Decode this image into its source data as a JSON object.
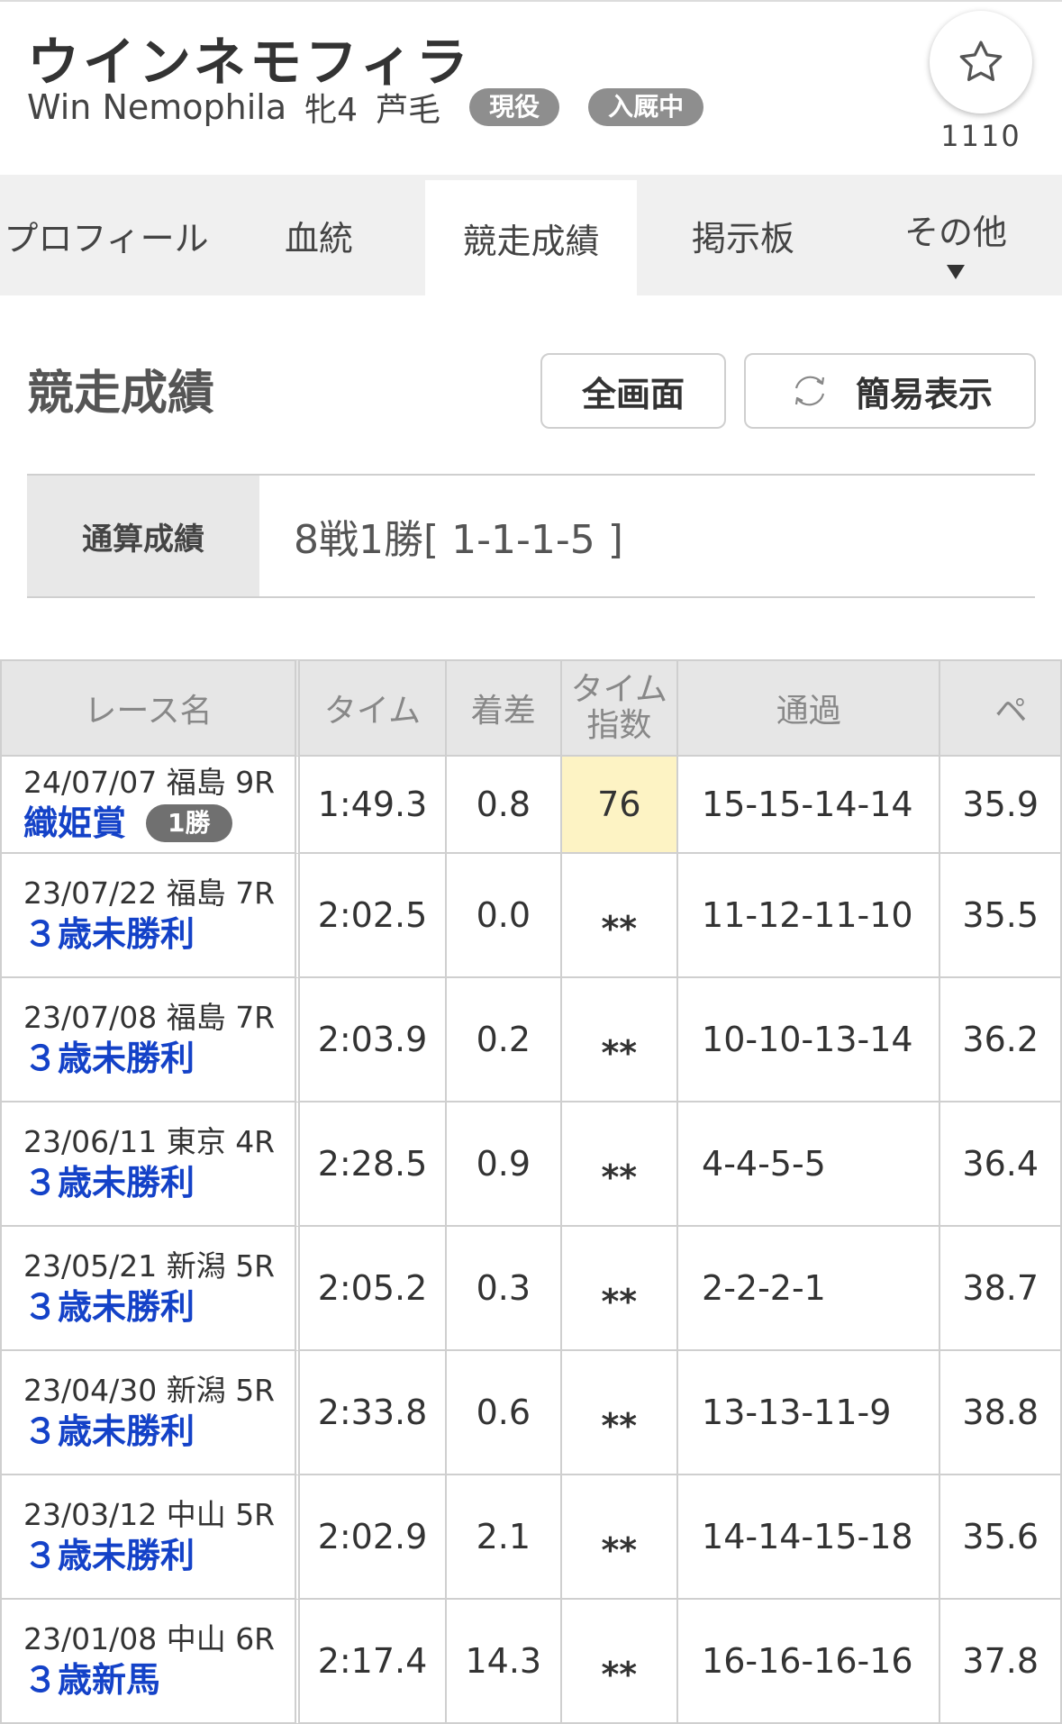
{
  "horse": {
    "name_jp": "ウインネモフィラ",
    "name_en": "Win Nemophila",
    "sex_age": "牝4",
    "coat": "芦毛",
    "status_badge": "現役",
    "stable_badge": "入厩中"
  },
  "favorite": {
    "icon": "star-icon",
    "count": "1110"
  },
  "tabs": [
    {
      "label": "プロフィール"
    },
    {
      "label": "血統"
    },
    {
      "label": "競走成績",
      "active": true
    },
    {
      "label": "掲示板"
    },
    {
      "label": "その他"
    }
  ],
  "section": {
    "title": "競走成績",
    "fullscreen_label": "全画面",
    "simple_label": "簡易表示",
    "simple_icon": "refresh-icon"
  },
  "summary": {
    "label": "通算成績",
    "value": "8戦1勝[ 1-1-1-5 ]"
  },
  "table": {
    "headers": {
      "race": "レース名",
      "time": "タイム",
      "margin": "着差",
      "time_index_1": "タイム",
      "time_index_2": "指数",
      "passing": "通過",
      "pace": "ペ"
    },
    "rows": [
      {
        "date_place": "24/07/07 福島 9R",
        "race": "織姫賞",
        "grade": "1勝",
        "time": "1:49.3",
        "margin": "0.8",
        "time_index": "76",
        "passing": "15-15-14-14",
        "pace": "35.9"
      },
      {
        "date_place": "23/07/22 福島 7R",
        "race": "３歳未勝利",
        "grade": "",
        "time": "2:02.5",
        "margin": "0.0",
        "time_index": "**",
        "passing": "11-12-11-10",
        "pace": "35.5"
      },
      {
        "date_place": "23/07/08 福島 7R",
        "race": "３歳未勝利",
        "grade": "",
        "time": "2:03.9",
        "margin": "0.2",
        "time_index": "**",
        "passing": "10-10-13-14",
        "pace": "36.2"
      },
      {
        "date_place": "23/06/11 東京 4R",
        "race": "３歳未勝利",
        "grade": "",
        "time": "2:28.5",
        "margin": "0.9",
        "time_index": "**",
        "passing": "4-4-5-5",
        "pace": "36.4"
      },
      {
        "date_place": "23/05/21 新潟 5R",
        "race": "３歳未勝利",
        "grade": "",
        "time": "2:05.2",
        "margin": "0.3",
        "time_index": "**",
        "passing": "2-2-2-1",
        "pace": "38.7"
      },
      {
        "date_place": "23/04/30 新潟 5R",
        "race": "３歳未勝利",
        "grade": "",
        "time": "2:33.8",
        "margin": "0.6",
        "time_index": "**",
        "passing": "13-13-11-9",
        "pace": "38.8"
      },
      {
        "date_place": "23/03/12 中山 5R",
        "race": "３歳未勝利",
        "grade": "",
        "time": "2:02.9",
        "margin": "2.1",
        "time_index": "**",
        "passing": "14-14-15-18",
        "pace": "35.6"
      },
      {
        "date_place": "23/01/08 中山 6R",
        "race": "３歳新馬",
        "grade": "",
        "time": "2:17.4",
        "margin": "14.3",
        "time_index": "**",
        "passing": "16-16-16-16",
        "pace": "37.8"
      }
    ]
  }
}
